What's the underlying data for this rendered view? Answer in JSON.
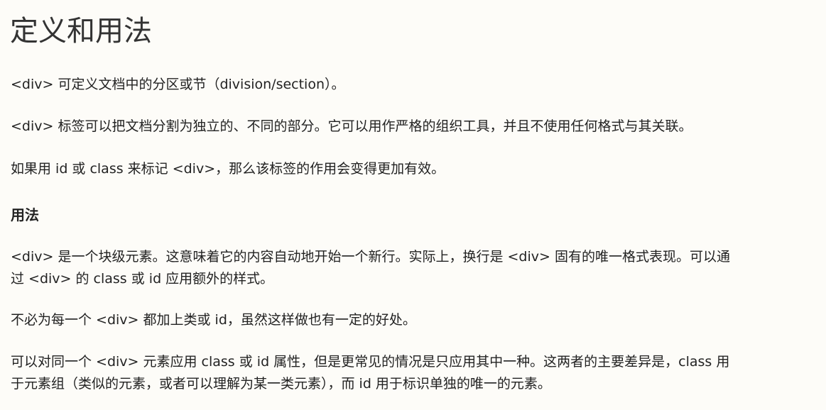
{
  "title": "定义和用法",
  "intro": [
    "<div> 可定义文档中的分区或节（division/section）。",
    "<div> 标签可以把文档分割为独立的、不同的部分。它可以用作严格的组织工具，并且不使用任何格式与其关联。",
    "如果用 id 或 class 来标记 <div>，那么该标签的作用会变得更加有效。"
  ],
  "usage": {
    "heading": "用法",
    "para1_line1": "<div> 是一个块级元素。这意味着它的内容自动地开始一个新行。实际上，换行是 <div> 固有的唯一格式表现。可以通",
    "para1_line2": "过 <div> 的 class 或 id 应用额外的样式。",
    "para2": "不必为每一个 <div> 都加上类或 id，虽然这样做也有一定的好处。",
    "para3_line1": "可以对同一个 <div> 元素应用 class 或 id 属性，但是更常见的情况是只应用其中一种。这两者的主要差异是，class 用",
    "para3_line2": "于元素组（类似的元素，或者可以理解为某一类元素），而 id 用于标识单独的唯一的元素。"
  }
}
